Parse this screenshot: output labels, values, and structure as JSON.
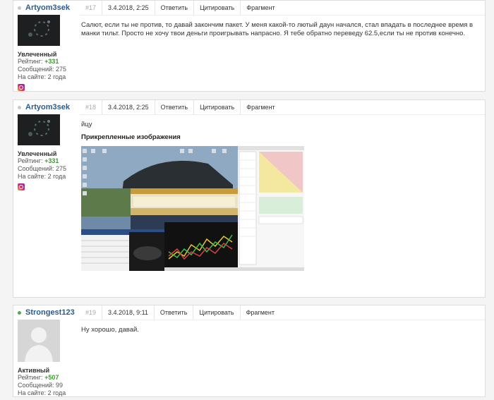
{
  "posts": [
    {
      "author": "Artyom3sek",
      "online": false,
      "number": "#17",
      "date": "3.4.2018, 2:25",
      "actions": {
        "reply": "Ответить",
        "quote": "Цитировать",
        "fragment": "Фрагмент"
      },
      "role": "Увлеченный",
      "rating_label": "Рейтинг:",
      "rating": "+331",
      "messages": "Сообщений: 275",
      "on_site": "На сайте: 2 года",
      "text": "Салют, если ты не против, то давай закончим пакет. У меня какой-то лютый даун начался, стал впадать в последнее время в манки тильт. Просто не хочу твои деньги проигрывать напрасно. Я тебе обратно переведу 62.5,если ты не против конечно.",
      "social_icon": "instagram-icon"
    },
    {
      "author": "Artyom3sek",
      "online": false,
      "number": "#18",
      "date": "3.4.2018, 2:25",
      "actions": {
        "reply": "Ответить",
        "quote": "Цитировать",
        "fragment": "Фрагмент"
      },
      "role": "Увлеченный",
      "rating_label": "Рейтинг:",
      "rating": "+331",
      "messages": "Сообщений: 275",
      "on_site": "На сайте: 2 года",
      "text": "йцу",
      "attachments_title": "Прикрепленные изображения",
      "social_icon": "instagram-icon"
    },
    {
      "author": "Strongest123",
      "online": true,
      "number": "#19",
      "date": "3.4.2018, 9:11",
      "actions": {
        "reply": "Ответить",
        "quote": "Цитировать",
        "fragment": "Фрагмент"
      },
      "role": "Активный",
      "rating_label": "Рейтинг:",
      "rating": "+507",
      "messages": "Сообщений: 99",
      "on_site": "На сайте: 2 года",
      "text": "Ну хорошо, давай."
    }
  ],
  "colors": {
    "link": "#2a5b8c",
    "rating": "#3a9b2e",
    "online": "#4cae4c",
    "offline": "#c8c8c8"
  }
}
